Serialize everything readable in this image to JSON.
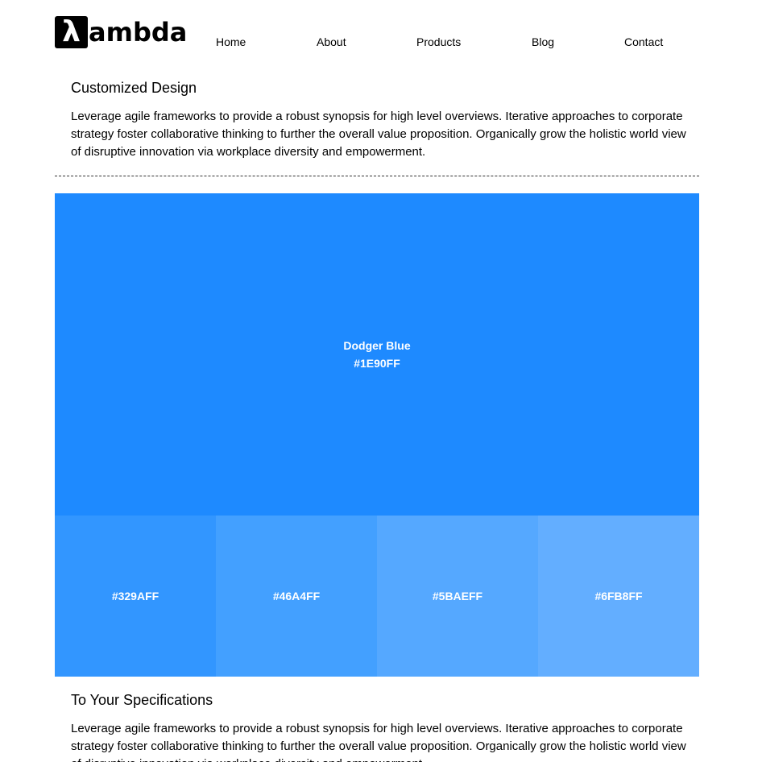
{
  "header": {
    "logo": {
      "mark": "λ",
      "text": "ambda"
    },
    "nav": [
      {
        "label": "Home"
      },
      {
        "label": "About"
      },
      {
        "label": "Products"
      },
      {
        "label": "Blog"
      },
      {
        "label": "Contact"
      }
    ]
  },
  "sections": [
    {
      "title": "Customized Design",
      "body": "Leverage agile frameworks to provide a robust synopsis for high level overviews. Iterative approaches to corporate strategy foster collaborative thinking to further the overall value proposition. Organically grow the holistic world view of disruptive innovation via workplace diversity and empowerment."
    },
    {
      "title": "To Your Specifications",
      "body": "Leverage agile frameworks to provide a robust synopsis for high level overviews. Iterative approaches to corporate strategy foster collaborative thinking to further the overall value proposition. Organically grow the holistic world view of disruptive innovation via workplace diversity and empowerment."
    }
  ],
  "palette": {
    "main": {
      "name": "Dodger Blue",
      "hex_label": "#1E90FF",
      "color": "#1E8AFF"
    },
    "shades": [
      {
        "hex_label": "#329AFF",
        "color": "#3296FF"
      },
      {
        "hex_label": "#46A4FF",
        "color": "#43A0FF"
      },
      {
        "hex_label": "#5BAEFF",
        "color": "#55A8FF"
      },
      {
        "hex_label": "#6FB8FF",
        "color": "#63AEFF"
      }
    ]
  }
}
